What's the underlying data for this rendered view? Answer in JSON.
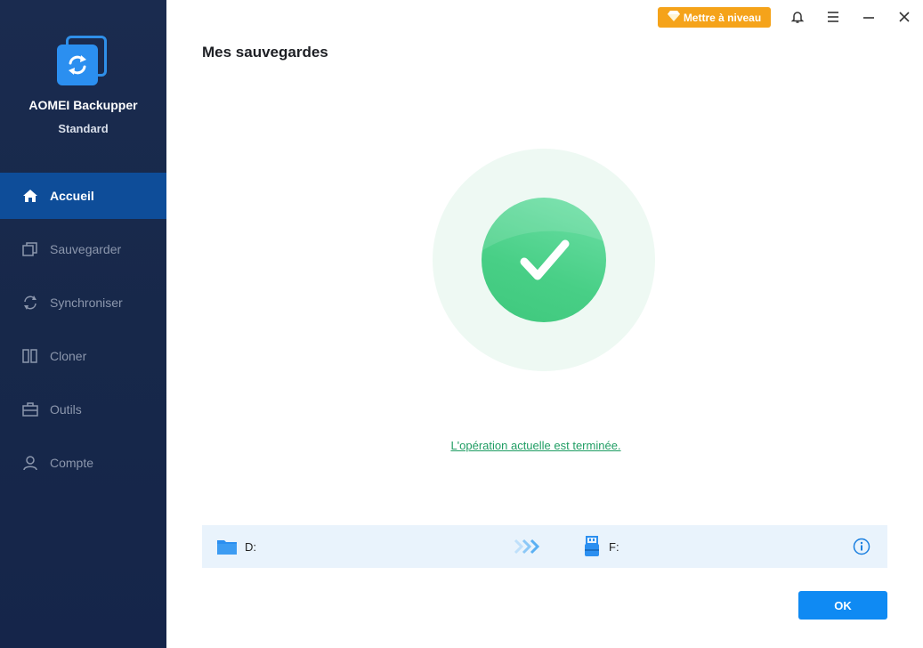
{
  "app": {
    "name": "AOMEI Backupper",
    "edition": "Standard",
    "logo_icon": "backup-sync-logo"
  },
  "sidebar": {
    "items": [
      {
        "label": "Accueil",
        "icon": "home-icon",
        "active": true
      },
      {
        "label": "Sauvegarder",
        "icon": "backup-icon",
        "active": false
      },
      {
        "label": "Synchroniser",
        "icon": "sync-icon",
        "active": false
      },
      {
        "label": "Cloner",
        "icon": "clone-icon",
        "active": false
      },
      {
        "label": "Outils",
        "icon": "toolbox-icon",
        "active": false
      },
      {
        "label": "Compte",
        "icon": "user-icon",
        "active": false
      }
    ]
  },
  "topbar": {
    "upgrade_label": "Mettre à niveau",
    "icons": [
      "bell-icon",
      "menu-icon",
      "close-icon"
    ]
  },
  "main": {
    "title": "Mes sauvegardes",
    "status_text": "L'opération actuelle est terminée.",
    "source_label": "D:",
    "destination_label": "F:",
    "ok_label": "OK"
  },
  "colors": {
    "sidebar_bg": "#1a2b4f",
    "active_nav": "#0e4d99",
    "upgrade": "#f5a31a",
    "success": "#48cf86",
    "link": "#1f9d63",
    "primary_button": "#0f8af3",
    "path_bar_bg": "#e9f3fc"
  }
}
